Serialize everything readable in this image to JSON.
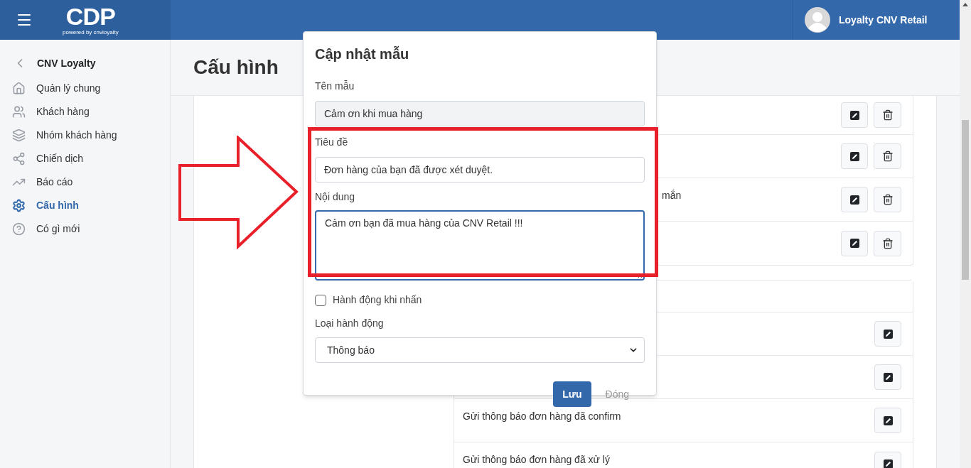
{
  "header": {
    "brand": "CDP",
    "tagline": "powered by cnvloyalty",
    "user": "Loyalty CNV Retail"
  },
  "sidebar": {
    "back_label": "CNV Loyalty",
    "items": [
      {
        "label": "Quản lý chung",
        "selected": false
      },
      {
        "label": "Khách hàng",
        "selected": false
      },
      {
        "label": "Nhóm khách hàng",
        "selected": false
      },
      {
        "label": "Chiến dịch",
        "selected": false
      },
      {
        "label": "Báo cáo",
        "selected": false
      },
      {
        "label": "Cấu hình",
        "selected": true
      },
      {
        "label": "Có gì mới",
        "selected": false
      }
    ]
  },
  "page_title": "Cấu hình",
  "cards": [
    {
      "has_header": false,
      "rows": [
        {
          "kind": "edit_delete"
        },
        {
          "kind": "edit_delete"
        },
        {
          "text": "mắn",
          "kind": "edit_delete"
        },
        {
          "kind": "edit_delete"
        }
      ]
    },
    {
      "has_header": true,
      "rows": [
        {
          "kind": "edit"
        },
        {
          "kind": "edit"
        },
        {
          "text": "Gửi thông báo đơn hàng đã confirm",
          "kind": "edit"
        },
        {
          "text": "Gửi thông báo đơn hàng đã xử lý",
          "kind": "edit"
        }
      ]
    }
  ],
  "modal": {
    "title": "Cập nhật mẫu",
    "name_label": "Tên mẫu",
    "name_value": "Cảm ơn khi mua hàng",
    "name_disabled": true,
    "subject_label": "Tiêu đề",
    "subject_value": "Đơn hàng của bạn đã được xét duyệt.",
    "content_label": "Nội dung",
    "content_value": "Cảm ơn bạn đã mua hàng của CNV Retail !!!",
    "checkbox": {
      "label": "Hành động khi nhấn",
      "checked": false
    },
    "action_label": "Loại hành động",
    "action_value": "Thông báo",
    "buttons": [
      "Lưu",
      "Đóng"
    ]
  }
}
